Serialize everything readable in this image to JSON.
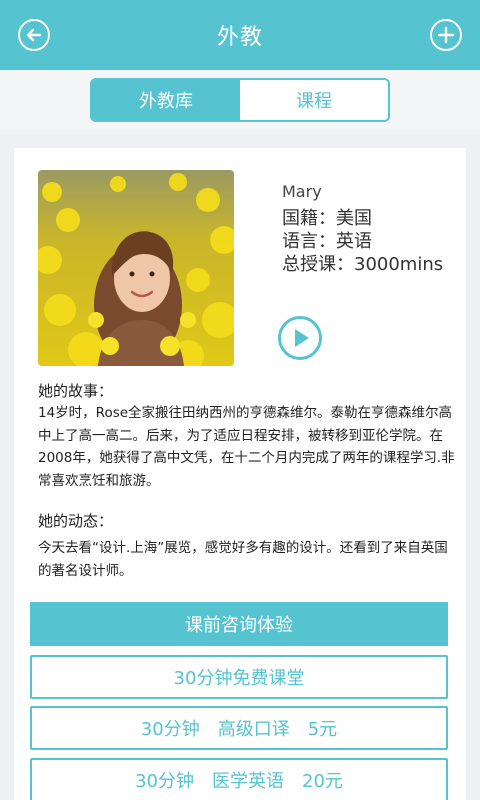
{
  "header": {
    "title": "外教",
    "back_icon": "arrow-left-icon",
    "add_icon": "plus-icon"
  },
  "tabs": [
    {
      "label": "外教库",
      "active": true
    },
    {
      "label": "课程",
      "active": false
    }
  ],
  "teacher": {
    "name": "Mary",
    "nationality": "国籍：美国",
    "language": "语言：英语",
    "total_lessons": "总授课：3000mins",
    "play_icon": "play-icon"
  },
  "story": {
    "title": "她的故事：",
    "text": "14岁时，Rose全家搬往田纳西州的亨德森维尔。泰勒在亨德森维尔高中上了高一高二。后来，为了适应日程安排，被转移到亚伦学院。在2008年，她获得了高中文凭，在十二个月内完成了两年的课程学习.非常喜欢烹饪和旅游。"
  },
  "activity": {
    "title": "她的动态：",
    "text": "今天去看“设计.上海”展览，感觉好多有趣的设计。还看到了来自英国的著名设计师。"
  },
  "actions": {
    "consult_label": "课前咨询体验",
    "options": [
      {
        "label": "30分钟免费课堂"
      },
      {
        "label": "30分钟　高级口译　5元"
      },
      {
        "label": "30分钟　医学英语　20元"
      }
    ]
  },
  "colors": {
    "accent": "#55c3d0",
    "background": "#eef0f3",
    "card": "#ffffff"
  }
}
